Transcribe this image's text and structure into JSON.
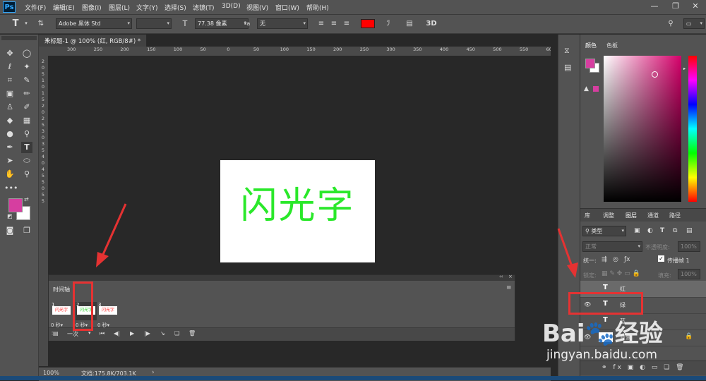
{
  "app": {
    "logo": "Ps"
  },
  "menu": [
    "文件(F)",
    "编辑(E)",
    "图像(I)",
    "图层(L)",
    "文字(Y)",
    "选择(S)",
    "滤镜(T)",
    "3D(D)",
    "视图(V)",
    "窗口(W)",
    "帮助(H)"
  ],
  "window_buttons": {
    "minimize": "—",
    "restore": "❐",
    "close": "✕"
  },
  "options": {
    "tool_icon": "T",
    "font_family": "Adobe 黑体 Std",
    "font_size": "77.38 像素",
    "aa_label": "ªa",
    "antialias": "无",
    "text_color": "#ff0000",
    "mode_3d": "3D"
  },
  "document": {
    "tab_title": "未标题-1 @ 100% (红, RGB/8#) *",
    "tab_close": "×",
    "text": "闪光字",
    "text_color": "#2ae82a"
  },
  "rulers": {
    "h": [
      "300",
      "250",
      "200",
      "150",
      "100",
      "50",
      "0",
      "50",
      "100",
      "150",
      "200",
      "250",
      "300",
      "350",
      "400",
      "450",
      "500",
      "550",
      "600"
    ],
    "v": [
      "2",
      "0",
      "5",
      "1",
      "0",
      "1",
      "5",
      "2",
      "0",
      "2",
      "5",
      "3",
      "0",
      "3",
      "5",
      "4",
      "0",
      "4",
      "5",
      "5",
      "0",
      "5",
      "5"
    ]
  },
  "status": {
    "zoom": "100%",
    "doc": "文档:175.8K/703.1K",
    "arrow": "›"
  },
  "timeline": {
    "title": "时间轴",
    "frames": [
      {
        "num": "1",
        "thumb": "闪光字",
        "thumb_color": "#ff2020",
        "delay": "0 秒▾"
      },
      {
        "num": "2",
        "thumb": "闪光字",
        "thumb_color": "#22cc22",
        "delay": "0 秒▾"
      },
      {
        "num": "3",
        "thumb": "闪光字",
        "thumb_color": "#ff2020",
        "delay": "0 秒▾"
      }
    ],
    "loop": "一次",
    "panel_menu": "≡"
  },
  "color_panel": {
    "tab_color": "颜色",
    "tab_swatch": "色板",
    "fg": "#d63ea0",
    "warn": "▲"
  },
  "layers_panel": {
    "tabs": [
      "库",
      "调整",
      "图层",
      "通道",
      "路径"
    ],
    "filter": "类型",
    "blend": "正常",
    "opacity_label": "不透明度:",
    "opacity": "100%",
    "unify_label": "统一:",
    "propagate": "传播帧 1",
    "lock_label": "锁定:",
    "fill_label": "填充:",
    "fill": "100%",
    "layers": [
      {
        "name": "红",
        "type": "T",
        "visible": ""
      },
      {
        "name": "绿",
        "type": "T",
        "visible": "👁"
      },
      {
        "name": "蓝",
        "type": "T",
        "visible": ""
      },
      {
        "name": "背景",
        "type": "",
        "visible": "👁"
      }
    ],
    "bottom_icons": "⚭ fx ▣ ◐ ▭ ❏ 🗑"
  },
  "watermark": {
    "logo": "Bai🐾经验",
    "url": "jingyan.baidu.com"
  }
}
